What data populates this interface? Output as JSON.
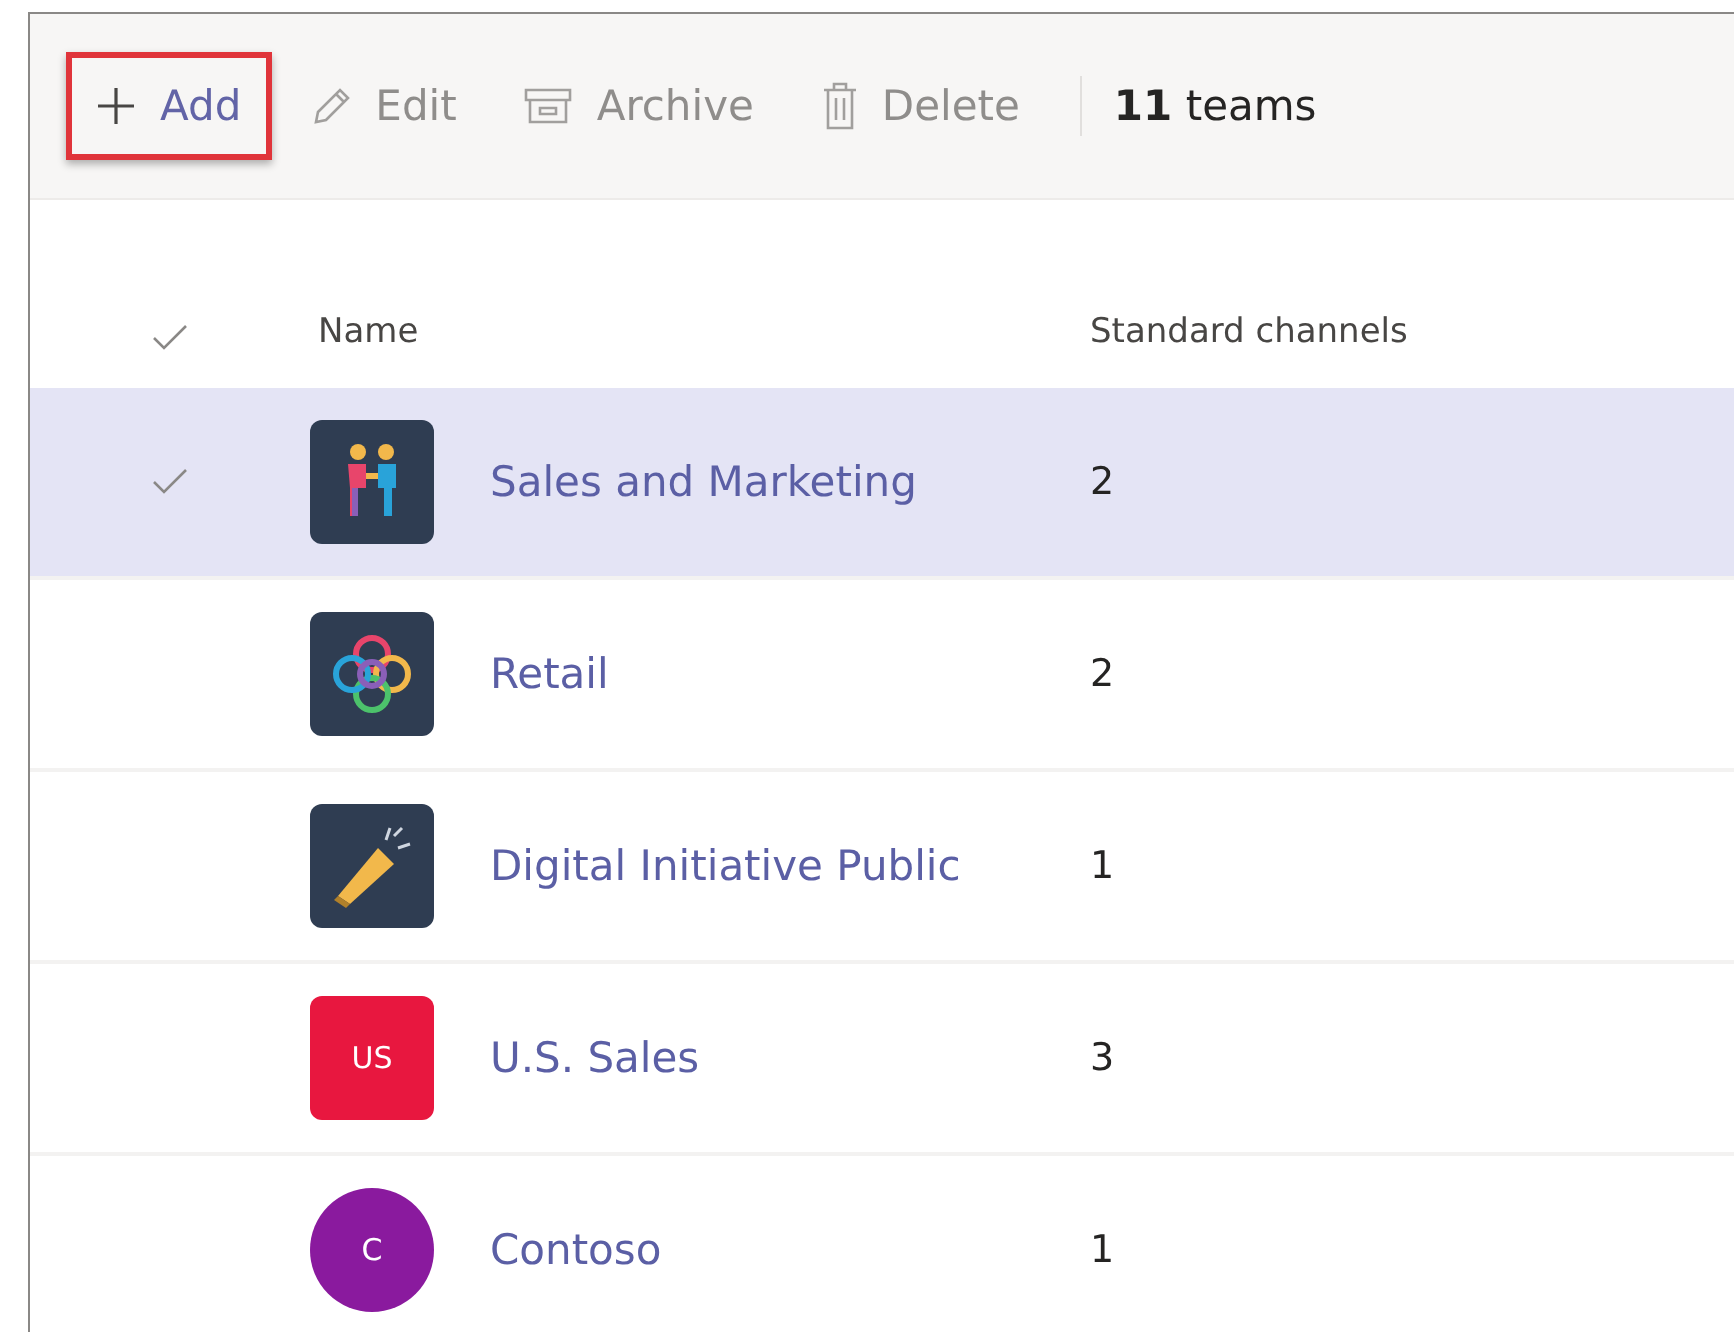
{
  "toolbar": {
    "buttons": [
      {
        "label": "Add",
        "kind": "plus",
        "disabled": false,
        "highlighted": true
      },
      {
        "label": "Edit",
        "kind": "pencil",
        "disabled": true,
        "highlighted": false
      },
      {
        "label": "Archive",
        "kind": "archive",
        "disabled": true,
        "highlighted": false
      },
      {
        "label": "Delete",
        "kind": "trash",
        "disabled": true,
        "highlighted": false
      }
    ],
    "count": "**11** teams"
  },
  "table": {
    "columns": [
      "Name",
      "Standard channels"
    ],
    "rows": [
      {
        "selected": true,
        "name": "Sales and Marketing",
        "channels": "2",
        "avatar": {
          "kind": "people"
        }
      },
      {
        "selected": false,
        "name": "Retail",
        "channels": "2",
        "avatar": {
          "kind": "flower"
        }
      },
      {
        "selected": false,
        "name": "Digital Initiative Public",
        "channels": "1",
        "avatar": {
          "kind": "megaphone"
        }
      },
      {
        "selected": false,
        "name": "U.S. Sales",
        "channels": "3",
        "avatar": {
          "kind": "square",
          "initials": "US",
          "color": "#e8173f"
        }
      },
      {
        "selected": false,
        "name": "Contoso",
        "channels": "1",
        "avatar": {
          "kind": "circle",
          "initials": "C",
          "color": "#8a1a9e"
        }
      }
    ]
  }
}
